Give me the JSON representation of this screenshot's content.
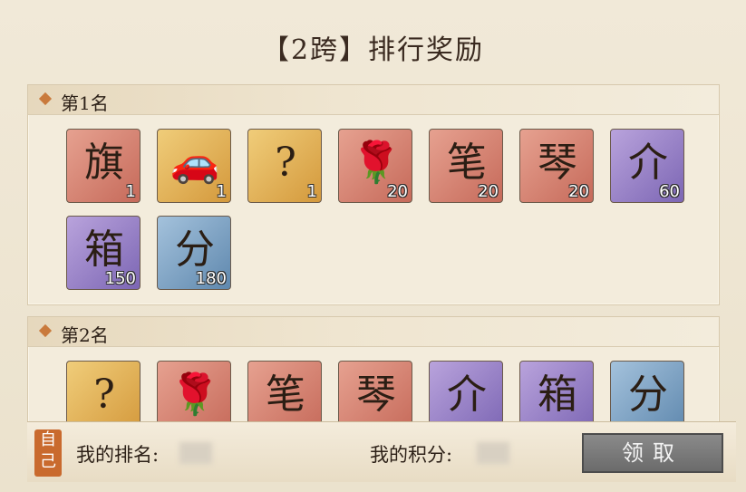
{
  "title": "【2跨】排行奖励",
  "sections": [
    {
      "label": "第1名",
      "items": [
        {
          "icon": "banner-icon",
          "glyph": "旗",
          "qty": "1",
          "bg": "red"
        },
        {
          "icon": "car-jar-icon",
          "glyph": "🚗",
          "qty": "1",
          "bg": "gold"
        },
        {
          "icon": "mystery-jar-icon",
          "glyph": "?",
          "qty": "1",
          "bg": "gold"
        },
        {
          "icon": "rose-dome-icon",
          "glyph": "🌹",
          "qty": "20",
          "bg": "red"
        },
        {
          "icon": "brush-icon",
          "glyph": "笔",
          "qty": "20",
          "bg": "red"
        },
        {
          "icon": "zither-icon",
          "glyph": "琴",
          "qty": "20",
          "bg": "red"
        },
        {
          "icon": "scroll-book-icon",
          "glyph": "介",
          "qty": "60",
          "bg": "purple"
        },
        {
          "icon": "green-box-icon",
          "glyph": "箱",
          "qty": "150",
          "bg": "purple"
        },
        {
          "icon": "score-card-icon",
          "glyph": "分",
          "qty": "180",
          "bg": "blue"
        }
      ]
    },
    {
      "label": "第2名",
      "items": [
        {
          "icon": "mystery-jar-icon",
          "glyph": "?",
          "qty": "",
          "bg": "gold"
        },
        {
          "icon": "rose-dome-icon",
          "glyph": "🌹",
          "qty": "",
          "bg": "red"
        },
        {
          "icon": "brush-icon",
          "glyph": "笔",
          "qty": "",
          "bg": "red"
        },
        {
          "icon": "zither-icon",
          "glyph": "琴",
          "qty": "",
          "bg": "red"
        },
        {
          "icon": "scroll-book-icon",
          "glyph": "介",
          "qty": "",
          "bg": "purple"
        },
        {
          "icon": "green-box-icon",
          "glyph": "箱",
          "qty": "",
          "bg": "purple"
        },
        {
          "icon": "score-card-icon",
          "glyph": "分",
          "qty": "",
          "bg": "blue"
        }
      ]
    }
  ],
  "footer": {
    "self_tag": "自己",
    "rank_label": "我的排名:",
    "score_label": "我的积分:",
    "claim_label": "领取"
  }
}
